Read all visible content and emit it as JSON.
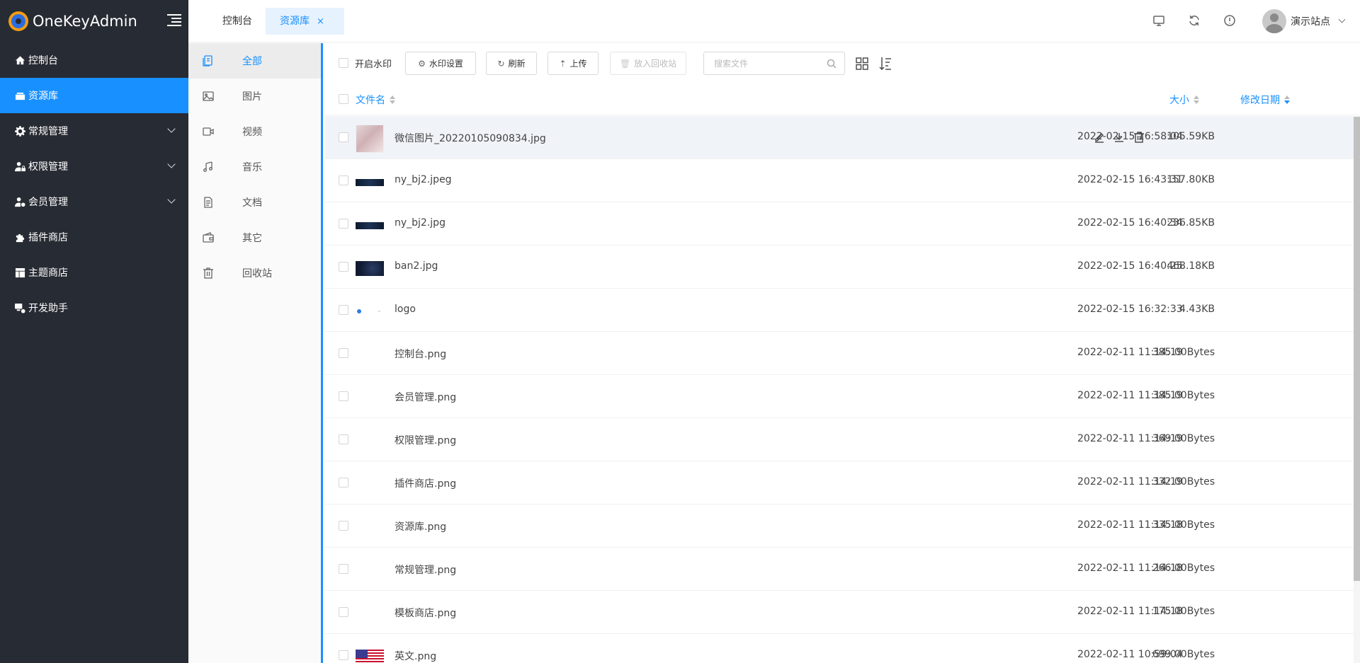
{
  "app": {
    "title": "OneKeyAdmin"
  },
  "sidebar": {
    "items": [
      {
        "label": "控制台",
        "icon": "home-icon",
        "active": false,
        "has_children": false
      },
      {
        "label": "资源库",
        "icon": "folder-icon",
        "active": true,
        "has_children": false
      },
      {
        "label": "常规管理",
        "icon": "gear-icon",
        "active": false,
        "has_children": true
      },
      {
        "label": "权限管理",
        "icon": "user-lock-icon",
        "active": false,
        "has_children": true
      },
      {
        "label": "会员管理",
        "icon": "user-cog-icon",
        "active": false,
        "has_children": true
      },
      {
        "label": "插件商店",
        "icon": "puzzle-icon",
        "active": false,
        "has_children": false
      },
      {
        "label": "主题商店",
        "icon": "layout-icon",
        "active": false,
        "has_children": false
      },
      {
        "label": "开发助手",
        "icon": "dev-tools-icon",
        "active": false,
        "has_children": false
      }
    ]
  },
  "header": {
    "tabs": [
      {
        "label": "控制台",
        "active": false
      },
      {
        "label": "资源库",
        "active": true,
        "close": "×"
      }
    ],
    "user": {
      "name": "演示站点"
    }
  },
  "categories": [
    {
      "label": "全部",
      "icon": "files-icon",
      "active": true
    },
    {
      "label": "图片",
      "icon": "image-icon",
      "active": false
    },
    {
      "label": "视频",
      "icon": "video-icon",
      "active": false
    },
    {
      "label": "音乐",
      "icon": "music-icon",
      "active": false
    },
    {
      "label": "文档",
      "icon": "document-icon",
      "active": false
    },
    {
      "label": "其它",
      "icon": "wallet-icon",
      "active": false
    },
    {
      "label": "回收站",
      "icon": "trash-icon",
      "active": false
    }
  ],
  "toolbar": {
    "watermark_label": "开启水印",
    "watermark_settings": "水印设置",
    "refresh": "刷新",
    "upload": "上传",
    "recycle": "放入回收站",
    "search_placeholder": "搜索文件"
  },
  "table": {
    "columns": {
      "name": "文件名",
      "size": "大小",
      "date": "修改日期"
    },
    "rows": [
      {
        "name": "微信图片_20220105090834.jpg",
        "size": "105.59KB",
        "date": "2022-02-15 16:58:04",
        "thumb": "photo"
      },
      {
        "name": "ny_bj2.jpeg",
        "size": "157.80KB",
        "date": "2022-02-15 16:43:31",
        "thumb": "banner"
      },
      {
        "name": "ny_bj2.jpg",
        "size": "236.85KB",
        "date": "2022-02-15 16:40:34",
        "thumb": "banner"
      },
      {
        "name": "ban2.jpg",
        "size": "468.18KB",
        "date": "2022-02-15 16:40:25",
        "thumb": "ban"
      },
      {
        "name": "logo",
        "size": "4.43KB",
        "date": "2022-02-15 16:32:33",
        "thumb": "logo"
      },
      {
        "name": "控制台.png",
        "size": "385.00Bytes",
        "date": "2022-02-11 11:14:19",
        "thumb": "blank"
      },
      {
        "name": "会员管理.png",
        "size": "385.00Bytes",
        "date": "2022-02-11 11:14:19",
        "thumb": "blank"
      },
      {
        "name": "权限管理.png",
        "size": "369.00Bytes",
        "date": "2022-02-11 11:14:19",
        "thumb": "blank"
      },
      {
        "name": "插件商店.png",
        "size": "332.00Bytes",
        "date": "2022-02-11 11:14:19",
        "thumb": "blank"
      },
      {
        "name": "资源库.png",
        "size": "335.00Bytes",
        "date": "2022-02-11 11:14:18",
        "thumb": "blank"
      },
      {
        "name": "常规管理.png",
        "size": "266.00Bytes",
        "date": "2022-02-11 11:14:18",
        "thumb": "blank"
      },
      {
        "name": "模板商店.png",
        "size": "175.00Bytes",
        "date": "2022-02-11 11:14:18",
        "thumb": "blank"
      },
      {
        "name": "英文.png",
        "size": "699.00Bytes",
        "date": "2022-02-11 10:59:04",
        "thumb": "flag"
      }
    ]
  }
}
